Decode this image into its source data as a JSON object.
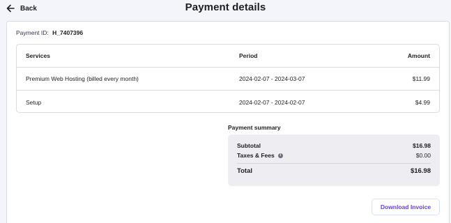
{
  "header": {
    "back_label": "Back",
    "title": "Payment details"
  },
  "payment": {
    "id_label": "Payment ID:",
    "id_value": "H_7407396"
  },
  "services_table": {
    "columns": [
      "Services",
      "Period",
      "Amount"
    ],
    "rows": [
      {
        "service": "Premium Web Hosting (billed every month)",
        "period": "2024-02-07 - 2024-03-07",
        "amount": "$11.99"
      },
      {
        "service": "Setup",
        "period": "2024-02-07 - 2024-02-07",
        "amount": "$4.99"
      }
    ]
  },
  "summary": {
    "title": "Payment summary",
    "subtotal_label": "Subtotal",
    "subtotal_value": "$16.98",
    "taxes_label": "Taxes & Fees",
    "taxes_value": "$0.00",
    "total_label": "Total",
    "total_value": "$16.98"
  },
  "actions": {
    "download_invoice_label": "Download Invoice"
  },
  "icons": {
    "back": "arrow-left-icon",
    "info": "info-icon"
  },
  "colors": {
    "accent": "#673de6",
    "page_bg": "#f4f4fb",
    "summary_bg": "#ededf2"
  }
}
